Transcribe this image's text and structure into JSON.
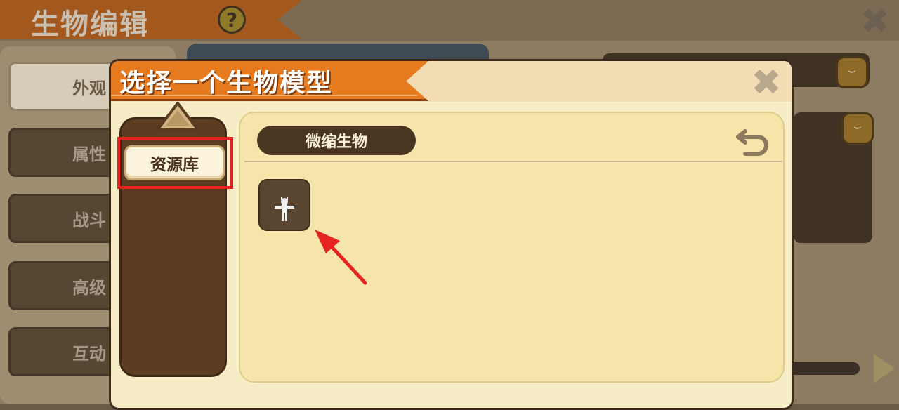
{
  "background_editor": {
    "title": "生物编辑",
    "help_icon": "question-icon",
    "close_icon": "close-icon",
    "tabs": [
      {
        "label": "外观",
        "active": true
      },
      {
        "label": "属性",
        "active": false
      },
      {
        "label": "战斗",
        "active": false
      },
      {
        "label": "高级",
        "active": false
      },
      {
        "label": "互动",
        "active": false
      }
    ]
  },
  "dialog": {
    "title": "选择一个生物模型",
    "close_icon": "close-icon",
    "sidebar": {
      "up_arrow_icon": "chevron-up-icon",
      "library_button": "资源库"
    },
    "content": {
      "category": "微缩生物",
      "back_icon": "undo-icon",
      "items": [
        {
          "icon": "humanoid-model-icon"
        }
      ]
    }
  },
  "annotations": {
    "highlight_color": "#e52421",
    "arrow_color": "#e52421"
  }
}
